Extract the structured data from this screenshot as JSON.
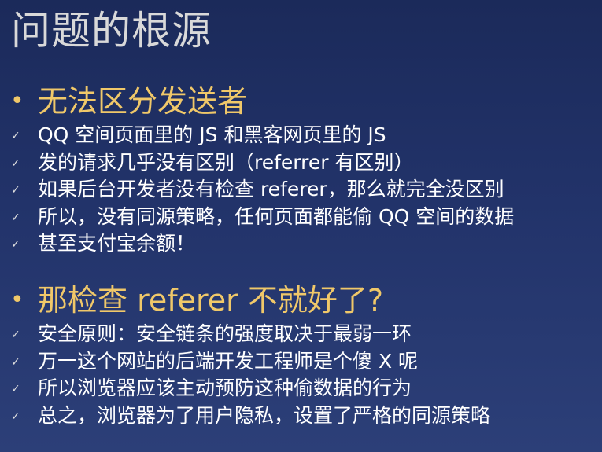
{
  "title": "问题的根源",
  "sections": [
    {
      "heading": "无法区分发送者",
      "items": [
        "QQ 空间页面里的 JS 和黑客网页里的 JS",
        "发的请求几乎没有区别（referrer 有区别）",
        "如果后台开发者没有检查 referer，那么就完全没区别",
        "所以，没有同源策略，任何页面都能偷 QQ 空间的数据",
        "甚至支付宝余额！"
      ]
    },
    {
      "heading": "那检查 referer 不就好了?",
      "items": [
        "安全原则：安全链条的强度取决于最弱一环",
        "万一这个网站的后端开发工程师是个傻 X 呢",
        "所以浏览器应该主动预防这种偷数据的行为",
        "总之，浏览器为了用户隐私，设置了严格的同源策略"
      ]
    }
  ],
  "icons": {
    "section_bullet": "•",
    "item_bullet": "✓"
  },
  "colors": {
    "background_top": "#1b2a5a",
    "background_bottom": "#2c3f78",
    "title": "#d9d9d9",
    "heading": "#f0c869",
    "body_text": "#ffffff"
  }
}
